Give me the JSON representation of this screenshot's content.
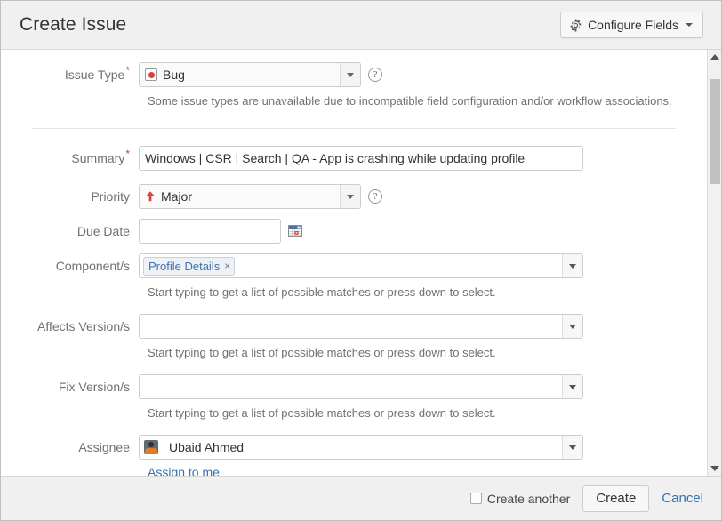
{
  "dialog": {
    "title": "Create Issue",
    "configure_fields_label": "Configure Fields"
  },
  "fields": {
    "issue_type": {
      "label": "Issue Type",
      "required": true,
      "value": "Bug",
      "icon": "bug-icon",
      "description": "Some issue types are unavailable due to incompatible field configuration and/or workflow associations.",
      "help_icon": "help-icon"
    },
    "summary": {
      "label": "Summary",
      "required": true,
      "value": "Windows | CSR | Search | QA - App is crashing while updating profile",
      "placeholder": ""
    },
    "priority": {
      "label": "Priority",
      "required": false,
      "value": "Major",
      "icon": "priority-major-up-arrow-icon",
      "help_icon": "help-icon"
    },
    "due_date": {
      "label": "Due Date",
      "required": false,
      "value": "",
      "placeholder": "",
      "icon": "calendar-icon"
    },
    "components": {
      "label": "Component/s",
      "required": false,
      "chips": [
        "Profile  Details"
      ],
      "chip_remove_label": "×",
      "description": "Start typing to get a list of possible matches or press down to select."
    },
    "affects_versions": {
      "label": "Affects Version/s",
      "required": false,
      "value": "",
      "description": "Start typing to get a list of possible matches or press down to select."
    },
    "fix_versions": {
      "label": "Fix Version/s",
      "required": false,
      "value": "",
      "description": "Start typing to get a list of possible matches or press down to select."
    },
    "assignee": {
      "label": "Assignee",
      "required": false,
      "value": "Ubaid Ahmed",
      "avatar": "user-avatar",
      "assign_to_me_label": "Assign to me"
    }
  },
  "footer": {
    "create_another_label": "Create another",
    "create_another_checked": false,
    "create_label": "Create",
    "cancel_label": "Cancel"
  },
  "scrollbar": {
    "up_arrow": "scroll-up-arrow",
    "down_arrow": "scroll-down-arrow"
  },
  "colors": {
    "required_asterisk": "#d04437",
    "link": "#3572b0",
    "bug_red": "#d04437",
    "chip_text": "#3b73af",
    "header_bg": "#f0f0f0"
  }
}
